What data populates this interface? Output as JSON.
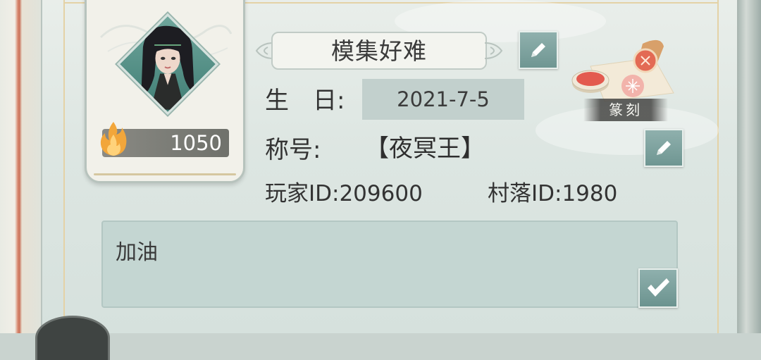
{
  "profile": {
    "name": "模集好难",
    "fire_value": "1050",
    "birthday_label": "生　日:",
    "birthday_value": "2021-7-5",
    "title_label": "称号:",
    "title_value": "【夜冥王】",
    "player_id_text": "玩家ID:209600",
    "village_id_text": "村落ID:1980"
  },
  "seal": {
    "label": "篆刻"
  },
  "signature": {
    "text": "加油"
  },
  "icons": {
    "edit_name": "pencil-icon",
    "edit_title": "pencil-icon",
    "confirm": "checkmark-icon",
    "fire": "fire-icon"
  },
  "colors": {
    "button_teal": "#7fa5a1",
    "input_bg": "#c4d6d2",
    "birthday_bg": "#c2d0cd",
    "fire_bar": "#7c7d77"
  }
}
